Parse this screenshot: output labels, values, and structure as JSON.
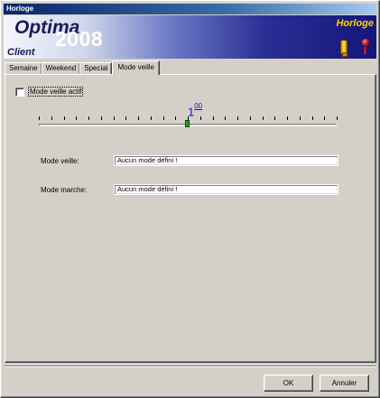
{
  "window": {
    "title": "Horloge"
  },
  "banner": {
    "logo_word": "Optima",
    "logo_year": "2008",
    "logo_subtitle": "Client",
    "app_name": "Horloge",
    "icons": [
      "bulb-icon",
      "alert-icon"
    ]
  },
  "tabs": [
    {
      "label": "Semaine",
      "active": false
    },
    {
      "label": "Weekend",
      "active": false
    },
    {
      "label": "Special",
      "active": false
    },
    {
      "label": "Mode veille",
      "active": true
    }
  ],
  "sleep_mode": {
    "checkbox_label": "Mode veille actif",
    "checked": false,
    "slider": {
      "value_main": "1",
      "value_sup": "00",
      "position_fraction": 0.5,
      "tick_count": 25
    },
    "fields": [
      {
        "label": "Mode veille:",
        "value": "Aucun mode défini !"
      },
      {
        "label": "Mode marche:",
        "value": "Aucun mode défini !"
      }
    ]
  },
  "buttons": {
    "ok": "OK",
    "cancel": "Annuler"
  },
  "colors": {
    "title_bar": "#0a246a",
    "banner_dark": "#15157a",
    "app_name": "#ffd200",
    "slider_value": "#1018b8",
    "slider_thumb": "#1ea028"
  }
}
